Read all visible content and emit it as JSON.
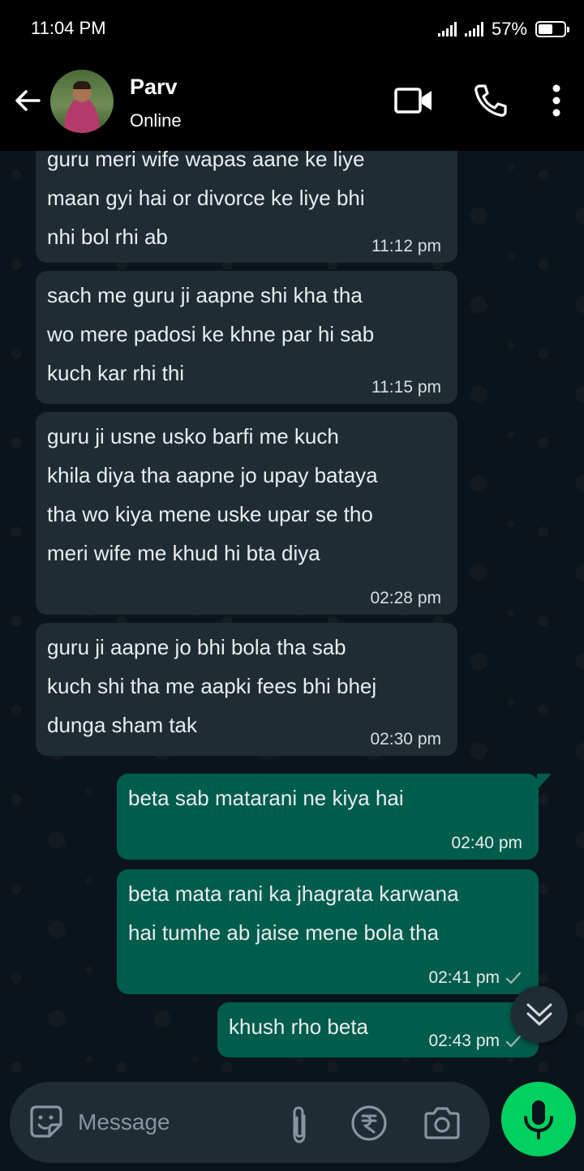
{
  "status_bar": {
    "time": "11:04 PM",
    "battery": "57%",
    "battery_level": 0.57
  },
  "header": {
    "name": "Parv",
    "status": "Online"
  },
  "messages": [
    {
      "direction": "in",
      "text": "guru meri wife wapas aane ke liye\nmaan gyi hai or divorce ke liye bhi\nnhi bol rhi ab",
      "time": "11:12 pm"
    },
    {
      "direction": "in",
      "text": " sach me guru ji aapne shi kha tha\nwo mere padosi ke khne par hi sab\nkuch kar rhi thi",
      "time": "11:15 pm"
    },
    {
      "direction": "in",
      "text": " guru ji usne usko barfi me kuch\nkhila diya tha aapne jo upay bataya\ntha wo kiya mene uske upar se tho\nmeri wife me khud hi bta diya",
      "time": "02:28 pm"
    },
    {
      "direction": "in",
      "text": " guru ji aapne jo bhi bola tha sab\nkuch shi tha me aapki fees bhi bhej\ndunga sham tak",
      "time": "02:30 pm"
    },
    {
      "direction": "out",
      "text": " beta sab matarani ne kiya hai",
      "time": "02:40 pm"
    },
    {
      "direction": "out",
      "text": " beta mata rani ka jhagrata karwana\nhai tumhe ab jaise mene bola tha",
      "time": "02:41 pm"
    },
    {
      "direction": "out",
      "text": " khush rho beta",
      "time": "02:43 pm"
    }
  ],
  "composer": {
    "placeholder": "Message"
  },
  "colors": {
    "incoming": "#1f2c34",
    "outgoing": "#005c4b",
    "mic": "#00d060",
    "background": "#0b141a"
  }
}
